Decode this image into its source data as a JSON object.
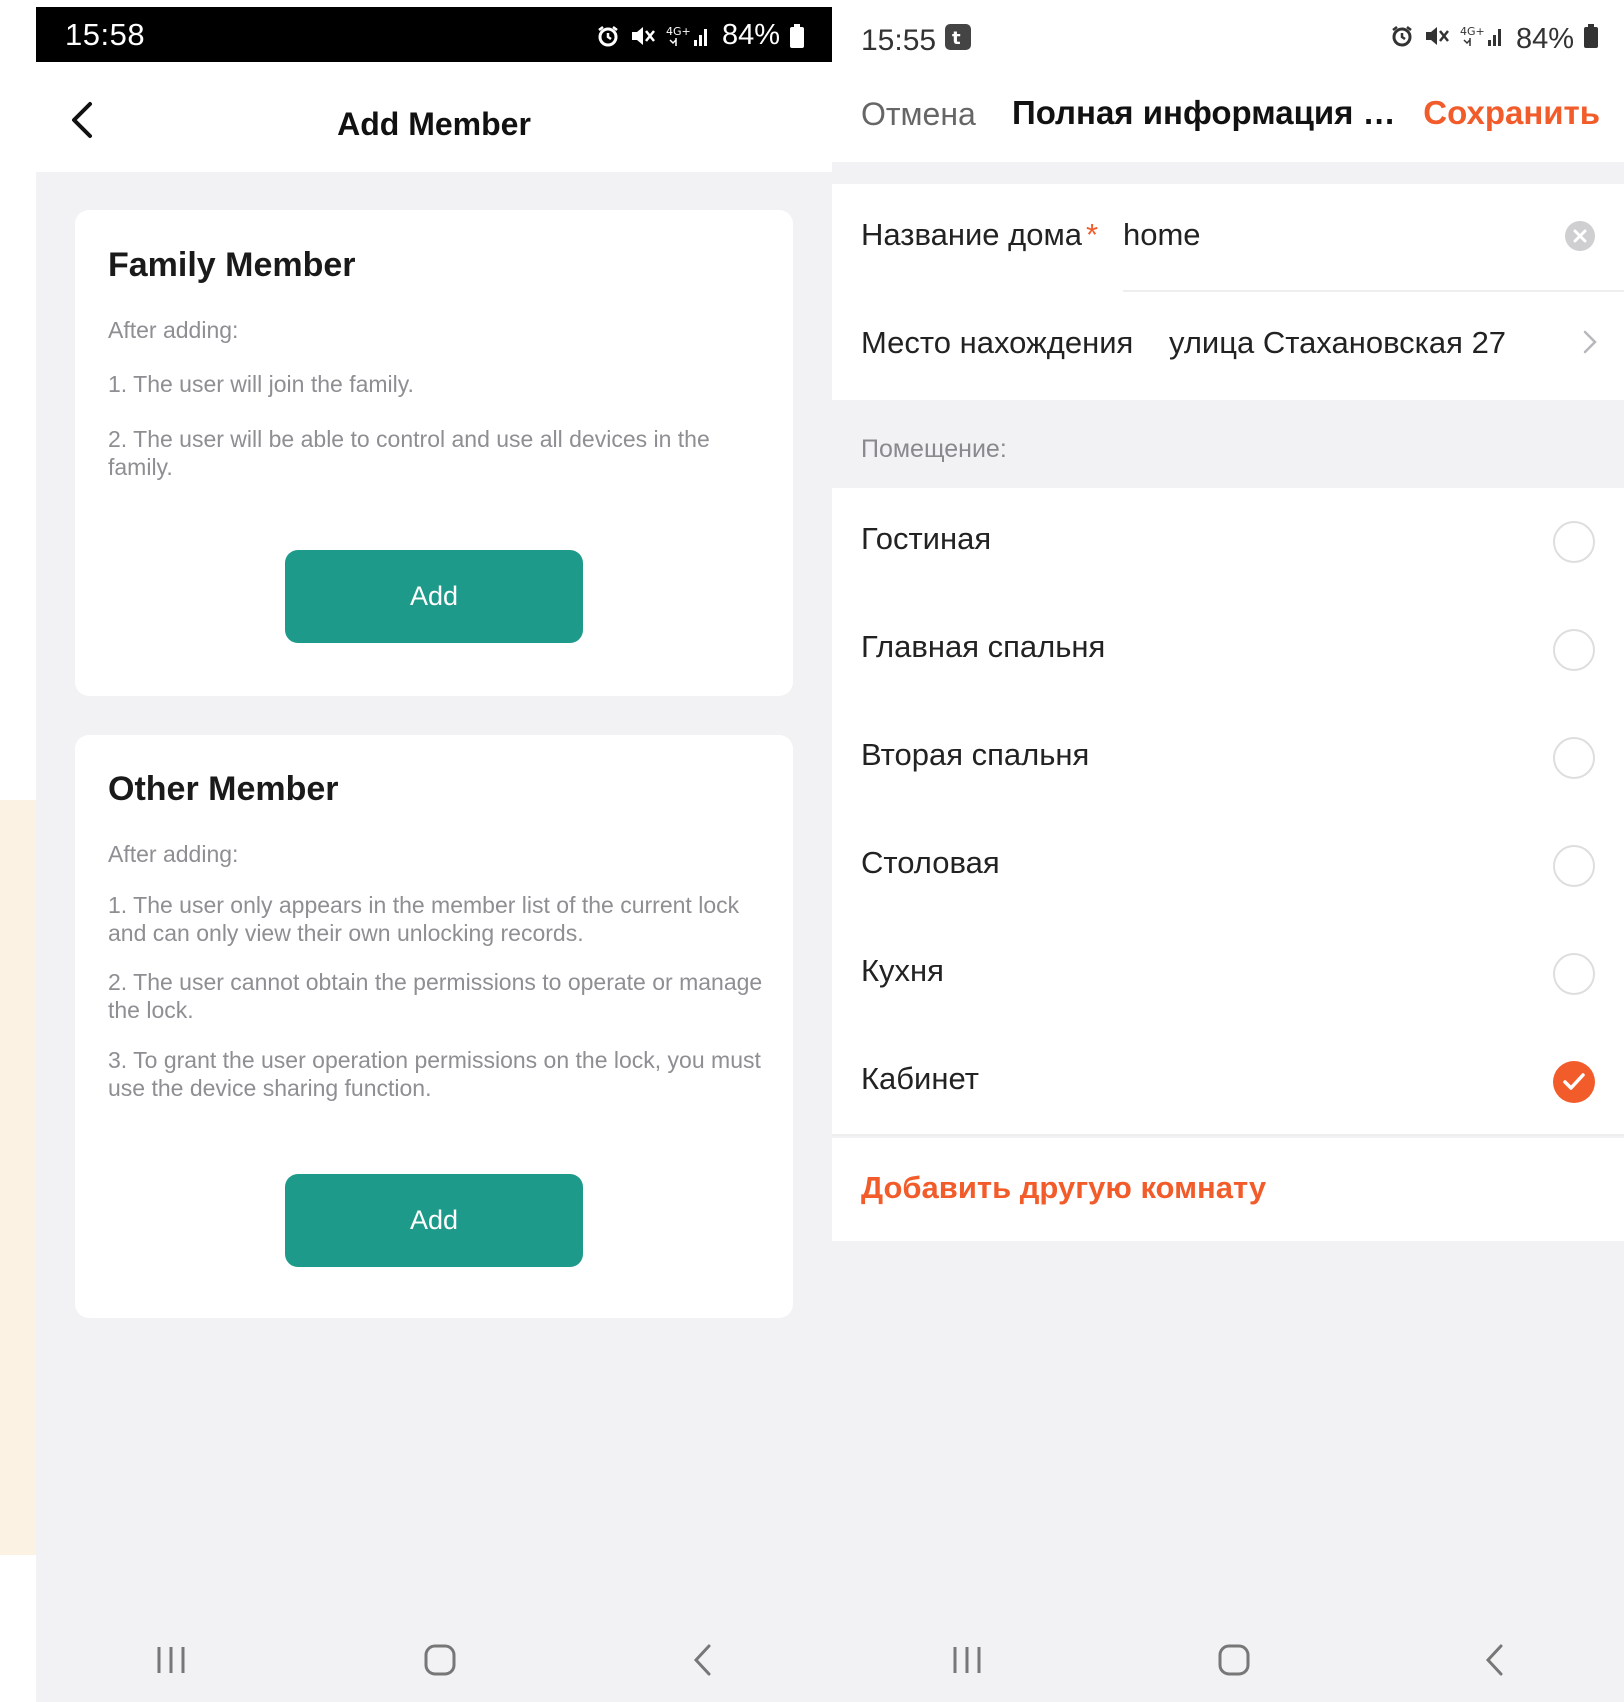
{
  "left_screen": {
    "status_bar": {
      "time": "15:58",
      "battery": "84%"
    },
    "header": {
      "title": "Add Member"
    },
    "family_card": {
      "title": "Family Member",
      "intro": "After adding:",
      "items": [
        "1. The user will join the family.",
        "2. The user will be able to control and use all devices in the family."
      ],
      "button_label": "Add"
    },
    "other_card": {
      "title": "Other Member",
      "intro": "After adding:",
      "items": [
        "1. The user only appears in the member list of the current lock and can only view their own unlocking records.",
        "2. The user cannot obtain the permissions to operate or manage the lock.",
        "3. To grant the user operation permissions on the lock, you must use the device sharing function."
      ],
      "button_label": "Add"
    }
  },
  "right_screen": {
    "status_bar": {
      "time": "15:55",
      "battery": "84%"
    },
    "header": {
      "cancel_label": "Отмена",
      "title": "Полная информация о...",
      "save_label": "Сохранить"
    },
    "home_name": {
      "label": "Название дома",
      "required_mark": "*",
      "value": "home"
    },
    "location": {
      "label": "Место нахождения",
      "value": "улица Стахановская 27"
    },
    "rooms_section_label": "Помещение:",
    "rooms": [
      {
        "name": "Гостиная",
        "checked": false
      },
      {
        "name": "Главная спальня",
        "checked": false
      },
      {
        "name": "Вторая спальня",
        "checked": false
      },
      {
        "name": "Столовая",
        "checked": false
      },
      {
        "name": "Кухня",
        "checked": false
      },
      {
        "name": "Кабинет",
        "checked": true
      }
    ],
    "add_room_label": "Добавить другую комнату"
  },
  "colors": {
    "accent_teal": "#1e9a8a",
    "accent_orange": "#f25c2a",
    "background_gray": "#f2f2f4"
  },
  "icons": [
    "back-chevron-icon",
    "alarm-icon",
    "mute-icon",
    "signal-4g-icon",
    "battery-icon",
    "clear-icon",
    "chevron-right-icon",
    "recents-icon",
    "home-icon",
    "back-icon"
  ]
}
